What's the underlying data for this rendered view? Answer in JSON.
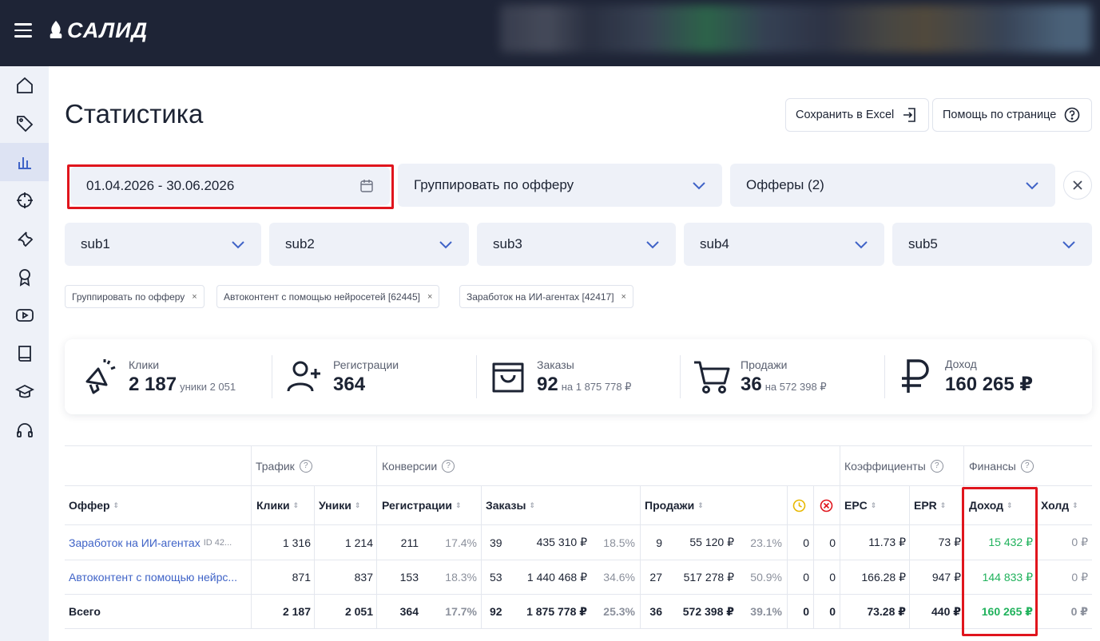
{
  "app": {
    "logo_text": "САЛИД"
  },
  "page": {
    "title": "Статистика",
    "save_excel": "Сохранить в Excel",
    "help": "Помощь по странице"
  },
  "filters": {
    "date_range": "01.04.2026 - 30.06.2026",
    "group_by": "Группировать по офферу",
    "offers": "Офферы (2)",
    "subs": [
      "sub1",
      "sub2",
      "sub3",
      "sub4",
      "sub5"
    ]
  },
  "chips": [
    "Группировать по офферу",
    "Автоконтент с помощью нейросетей [62445]",
    "Заработок на ИИ-агентах [42417]"
  ],
  "stats": {
    "clicks": {
      "label": "Клики",
      "value": "2 187",
      "sub": "уники 2 051"
    },
    "registrations": {
      "label": "Регистрации",
      "value": "364"
    },
    "orders": {
      "label": "Заказы",
      "value": "92",
      "sub": "на 1 875 778 ₽"
    },
    "sales": {
      "label": "Продажи",
      "value": "36",
      "sub": "на 572 398 ₽"
    },
    "income": {
      "label": "Доход",
      "value": "160 265 ₽"
    }
  },
  "table": {
    "groups": {
      "traffic": "Трафик",
      "conversions": "Конверсии",
      "coefficients": "Коэффициенты",
      "finance": "Финансы"
    },
    "columns": {
      "offer": "Оффер",
      "clicks": "Клики",
      "uniques": "Уники",
      "registrations": "Регистрации",
      "orders": "Заказы",
      "sales": "Продажи",
      "epc": "EPC",
      "epr": "EPR",
      "income": "Доход",
      "hold": "Холд"
    },
    "rows": [
      {
        "offer": "Заработок на ИИ-агентах",
        "offer_id": "ID 42...",
        "clicks": "1 316",
        "uniques": "1 214",
        "reg": "211",
        "reg_pct": "17.4%",
        "orders": "39",
        "orders_sum": "435 310 ₽",
        "orders_pct": "18.5%",
        "sales": "9",
        "sales_sum": "55 120 ₽",
        "sales_pct": "23.1%",
        "pending": "0",
        "rejected": "0",
        "epc": "11.73 ₽",
        "epr": "73 ₽",
        "income": "15 432 ₽",
        "hold": "0 ₽"
      },
      {
        "offer": "Автоконтент с помощью нейрс...",
        "offer_id": "",
        "clicks": "871",
        "uniques": "837",
        "reg": "153",
        "reg_pct": "18.3%",
        "orders": "53",
        "orders_sum": "1 440 468 ₽",
        "orders_pct": "34.6%",
        "sales": "27",
        "sales_sum": "517 278 ₽",
        "sales_pct": "50.9%",
        "pending": "0",
        "rejected": "0",
        "epc": "166.28 ₽",
        "epr": "947 ₽",
        "income": "144 833 ₽",
        "hold": "0 ₽"
      },
      {
        "offer": "Всего",
        "offer_id": "",
        "clicks": "2 187",
        "uniques": "2 051",
        "reg": "364",
        "reg_pct": "17.7%",
        "orders": "92",
        "orders_sum": "1 875 778 ₽",
        "orders_pct": "25.3%",
        "sales": "36",
        "sales_sum": "572 398 ₽",
        "sales_pct": "39.1%",
        "pending": "0",
        "rejected": "0",
        "epc": "73.28 ₽",
        "epr": "440 ₽",
        "income": "160 265 ₽",
        "hold": "0 ₽"
      }
    ]
  },
  "colors": {
    "topbar": "#1e2436",
    "sidebar": "#eef1f8",
    "accent_link": "#3f63c7",
    "income_green": "#20b25c",
    "highlight_red": "#e0151d"
  }
}
